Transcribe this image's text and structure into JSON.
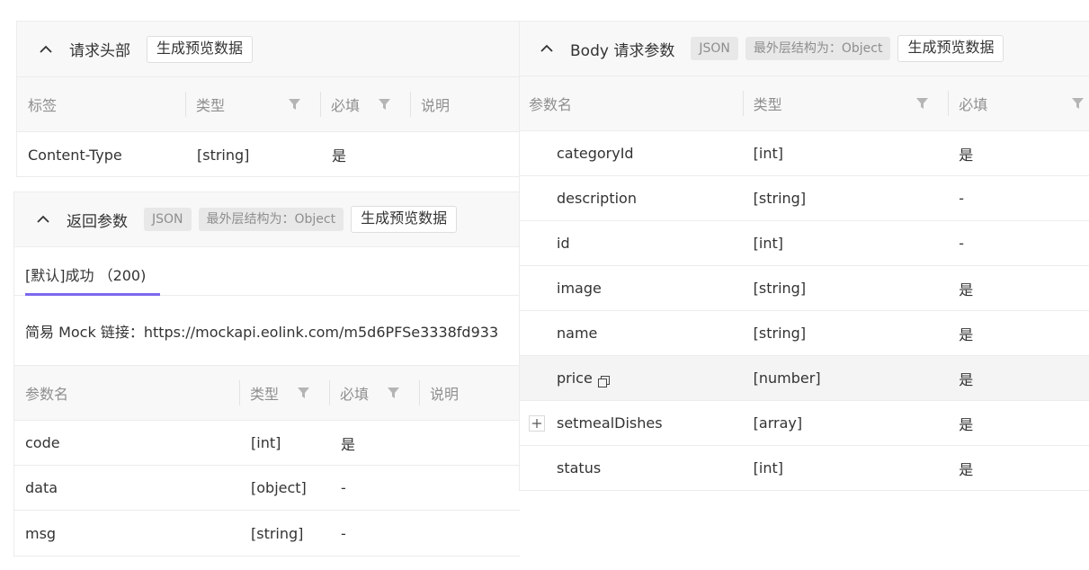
{
  "headers_panel": {
    "title": "请求头部",
    "preview_button": "生成预览数据",
    "columns": [
      "标签",
      "类型",
      "必填",
      "说明"
    ],
    "rows": [
      {
        "name": "Content-Type",
        "type": "[string]",
        "required": "是"
      }
    ]
  },
  "response_panel": {
    "title": "返回参数",
    "format_tag": "JSON",
    "structure_tag": "最外层结构为：Object",
    "preview_button": "生成预览数据",
    "tab_label": "[默认]成功 （200)",
    "mock_text": "简易 Mock 链接：https://mockapi.eolink.com/m5d6PFSe3338fd933",
    "columns": [
      "参数名",
      "类型",
      "必填",
      "说明"
    ],
    "rows": [
      {
        "name": "code",
        "type": "[int]",
        "required": "是"
      },
      {
        "name": "data",
        "type": "[object]",
        "required": "-"
      },
      {
        "name": "msg",
        "type": "[string]",
        "required": "-"
      }
    ]
  },
  "body_panel": {
    "title": "Body 请求参数",
    "format_tag": "JSON",
    "structure_tag": "最外层结构为：Object",
    "preview_button": "生成预览数据",
    "columns": [
      "参数名",
      "类型",
      "必填"
    ],
    "rows": [
      {
        "name": "categoryId",
        "type": "[int]",
        "required": "是"
      },
      {
        "name": "description",
        "type": "[string]",
        "required": "-"
      },
      {
        "name": "id",
        "type": "[int]",
        "required": "-"
      },
      {
        "name": "image",
        "type": "[string]",
        "required": "是"
      },
      {
        "name": "name",
        "type": "[string]",
        "required": "是"
      },
      {
        "name": "price",
        "type": "[number]",
        "required": "是"
      },
      {
        "name": "setmealDishes",
        "type": "[array]",
        "required": "是"
      },
      {
        "name": "status",
        "type": "[int]",
        "required": "是"
      }
    ]
  },
  "colors": {
    "tab_underline": "#7b68ee",
    "border": "#ececec",
    "header_bg": "#f8f8f8"
  }
}
